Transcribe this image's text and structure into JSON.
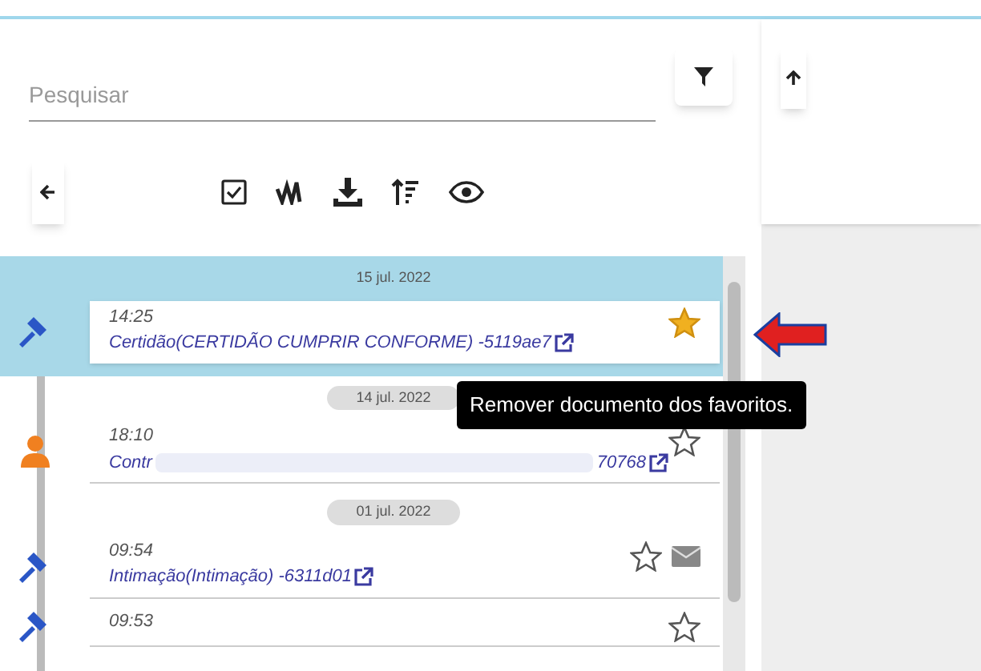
{
  "search": {
    "placeholder": "Pesquisar"
  },
  "timeline": [
    {
      "date": "15 jul. 2022",
      "time": "14:25",
      "title": "Certidão(CERTIDÃO CUMPRIR CONFORME) -5119ae7",
      "kind": "gavel",
      "starred": true,
      "selected": true,
      "mail": false
    },
    {
      "date": "14 jul. 2022",
      "time": "18:10",
      "title": "Contr",
      "suffix": "70768",
      "kind": "person",
      "starred": false,
      "selected": false,
      "mail": false,
      "redacted": true
    },
    {
      "date": "01 jul. 2022",
      "time": "09:54",
      "title": "Intimação(Intimação) -6311d01",
      "kind": "gavel",
      "starred": false,
      "selected": false,
      "mail": true
    },
    {
      "time": "09:53",
      "kind": "gavel",
      "starred": false,
      "selected": false,
      "mail": false
    }
  ],
  "tooltip": "Remover documento dos favoritos."
}
